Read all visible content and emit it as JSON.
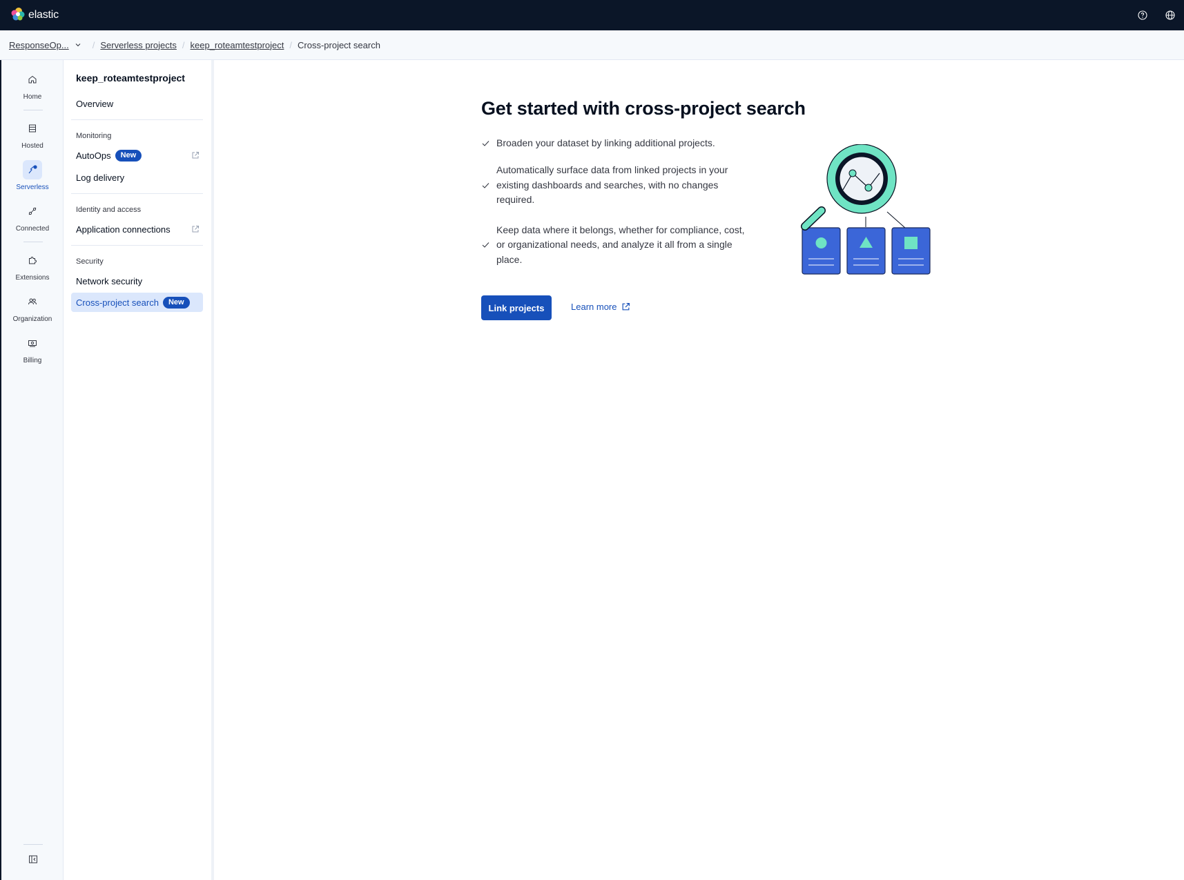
{
  "header": {
    "brand": "elastic",
    "logo_icon": "elastic-cluster-logo",
    "help_icon": "help-circle-icon",
    "language_icon": "globe-icon"
  },
  "breadcrumbs": {
    "org": "ResponseOp...",
    "items": [
      "Serverless projects",
      "keep_roteamtestproject"
    ],
    "current": "Cross-project search"
  },
  "rail": {
    "items": [
      {
        "label": "Home",
        "icon": "home-icon"
      },
      {
        "label": "Hosted",
        "icon": "hosted-icon"
      },
      {
        "label": "Serverless",
        "icon": "serverless-icon",
        "active": true
      },
      {
        "label": "Connected",
        "icon": "connected-icon"
      },
      {
        "label": "Extensions",
        "icon": "puzzle-icon"
      },
      {
        "label": "Organization",
        "icon": "users-icon"
      },
      {
        "label": "Billing",
        "icon": "billing-icon"
      }
    ],
    "collapse_icon": "collapse-sidebar-icon"
  },
  "subnav": {
    "project_title": "keep_roteamtestproject",
    "overview": "Overview",
    "monitoring": {
      "title": "Monitoring",
      "autoops": "AutoOps",
      "autoops_badge": "New",
      "log_delivery": "Log delivery"
    },
    "identity": {
      "title": "Identity and access",
      "app_connections": "Application connections"
    },
    "security": {
      "title": "Security",
      "network_security": "Network security",
      "cross_project": "Cross-project search",
      "cross_project_badge": "New"
    }
  },
  "main": {
    "heading": "Get started with cross-project search",
    "bullets": [
      "Broaden your dataset by linking additional projects.",
      "Automatically surface data from linked projects in your existing dashboards and searches, with no changes required.",
      "Keep data where it belongs, whether for compliance, cost, or organizational needs, and analyze it all from a single place."
    ],
    "primary_button": "Link projects",
    "learn_more": "Learn more"
  },
  "colors": {
    "header_bg": "#0b1628",
    "primary": "#1750ba",
    "accent_teal": "#6fe4c4",
    "active_bg": "#dbe7fc"
  }
}
